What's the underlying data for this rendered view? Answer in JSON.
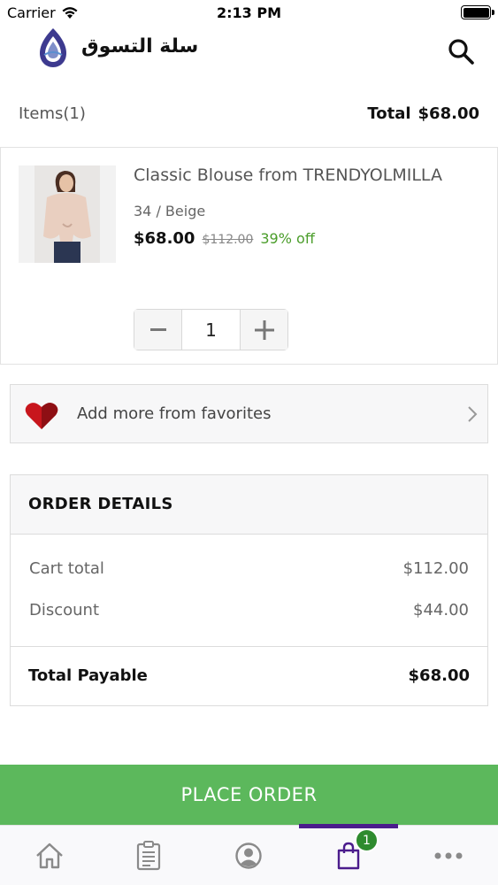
{
  "status_bar": {
    "carrier": "Carrier",
    "time": "2:13 PM",
    "battery_level": 1.0
  },
  "header": {
    "brand": "سلة التسوق",
    "search_icon": "search-icon"
  },
  "summary": {
    "items_label": "Items(1)",
    "total_label": "Total",
    "total_value": "$68.00"
  },
  "cart_item": {
    "title": "Classic Blouse from TRENDYOLMILLA",
    "variant": "34 / Beige",
    "price": "$68.00",
    "old_price": "$112.00",
    "discount": "39% off",
    "quantity": "1"
  },
  "favorites": {
    "label": "Add more from favorites"
  },
  "order_details": {
    "heading": "ORDER DETAILS",
    "rows": [
      {
        "label": "Cart total",
        "value": "$112.00"
      },
      {
        "label": "Discount",
        "value": "$44.00"
      }
    ],
    "total_label": "Total Payable",
    "total_value": "$68.00"
  },
  "place_order": {
    "label": "PLACE ORDER"
  },
  "tabbar": {
    "tabs": [
      {
        "name": "home-icon"
      },
      {
        "name": "orders-icon"
      },
      {
        "name": "profile-icon"
      },
      {
        "name": "cart-icon",
        "active": true,
        "badge": "1"
      },
      {
        "name": "more-icon"
      }
    ]
  },
  "colors": {
    "accent": "#4b1c8c",
    "place_order": "#5cb85c",
    "discount": "#4a9d2a",
    "badge": "#2e8b2e"
  }
}
